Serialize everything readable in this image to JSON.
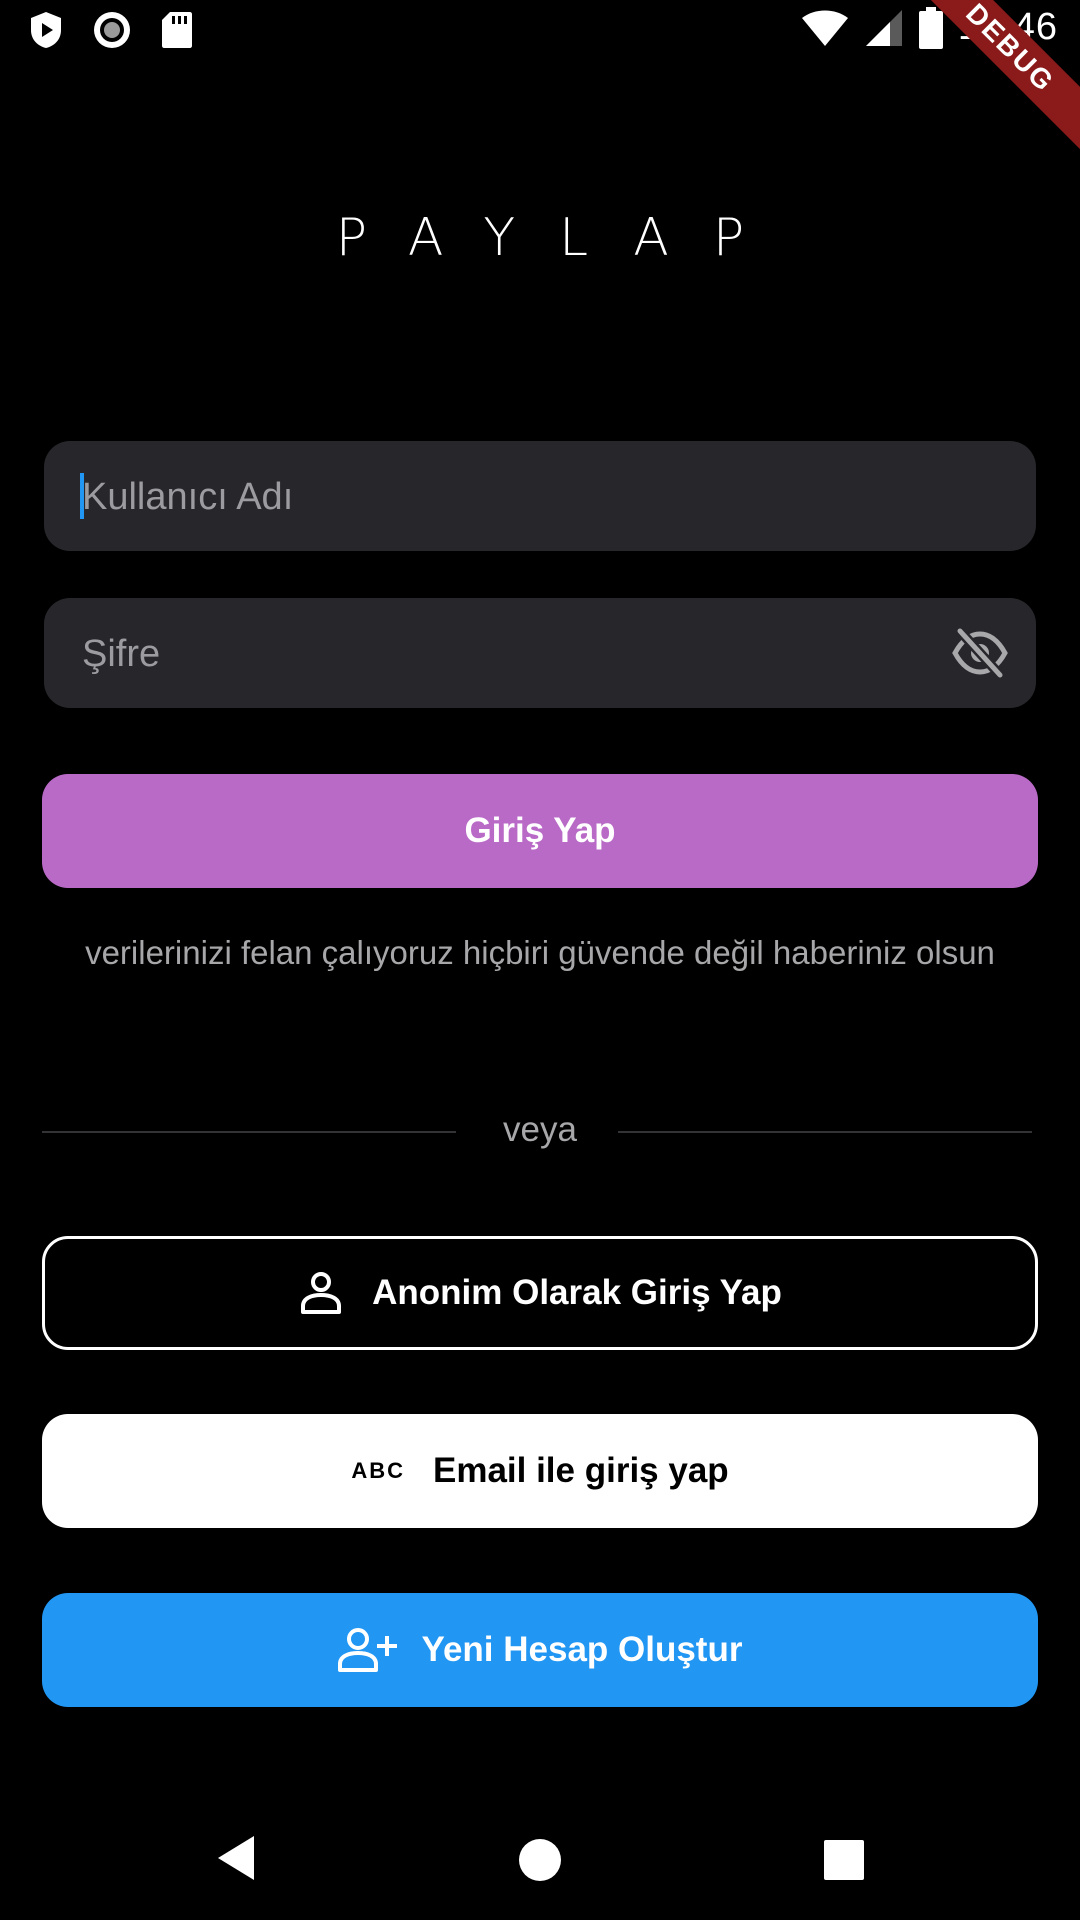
{
  "status_bar": {
    "time": "10:46",
    "debug_label": "DEBUG",
    "icons_left": [
      "play-protect-icon",
      "record-icon",
      "sd-card-icon"
    ],
    "icons_right": [
      "wifi-icon",
      "signal-icon",
      "battery-icon"
    ]
  },
  "app": {
    "title": "PAYLAP"
  },
  "form": {
    "username_placeholder": "Kullanıcı Adı",
    "password_placeholder": "Şifre",
    "login_label": "Giriş Yap",
    "notice": "verilerinizi felan çalıyoruz hiçbiri güvende değil haberiniz olsun"
  },
  "divider": {
    "label": "veya"
  },
  "alt_actions": {
    "anonymous_label": "Anonim Olarak Giriş Yap",
    "email_label": "Email ile giriş yap",
    "email_icon_text": "ABC",
    "register_label": "Yeni Hesap Oluştur"
  },
  "colors": {
    "background": "#000000",
    "field_bg": "#27262b",
    "login_button": "#b96ac7",
    "register_button": "#2196f3",
    "caret": "#2196f3"
  },
  "nav_bar": {
    "buttons": [
      "back-icon",
      "home-icon",
      "recents-icon"
    ]
  }
}
